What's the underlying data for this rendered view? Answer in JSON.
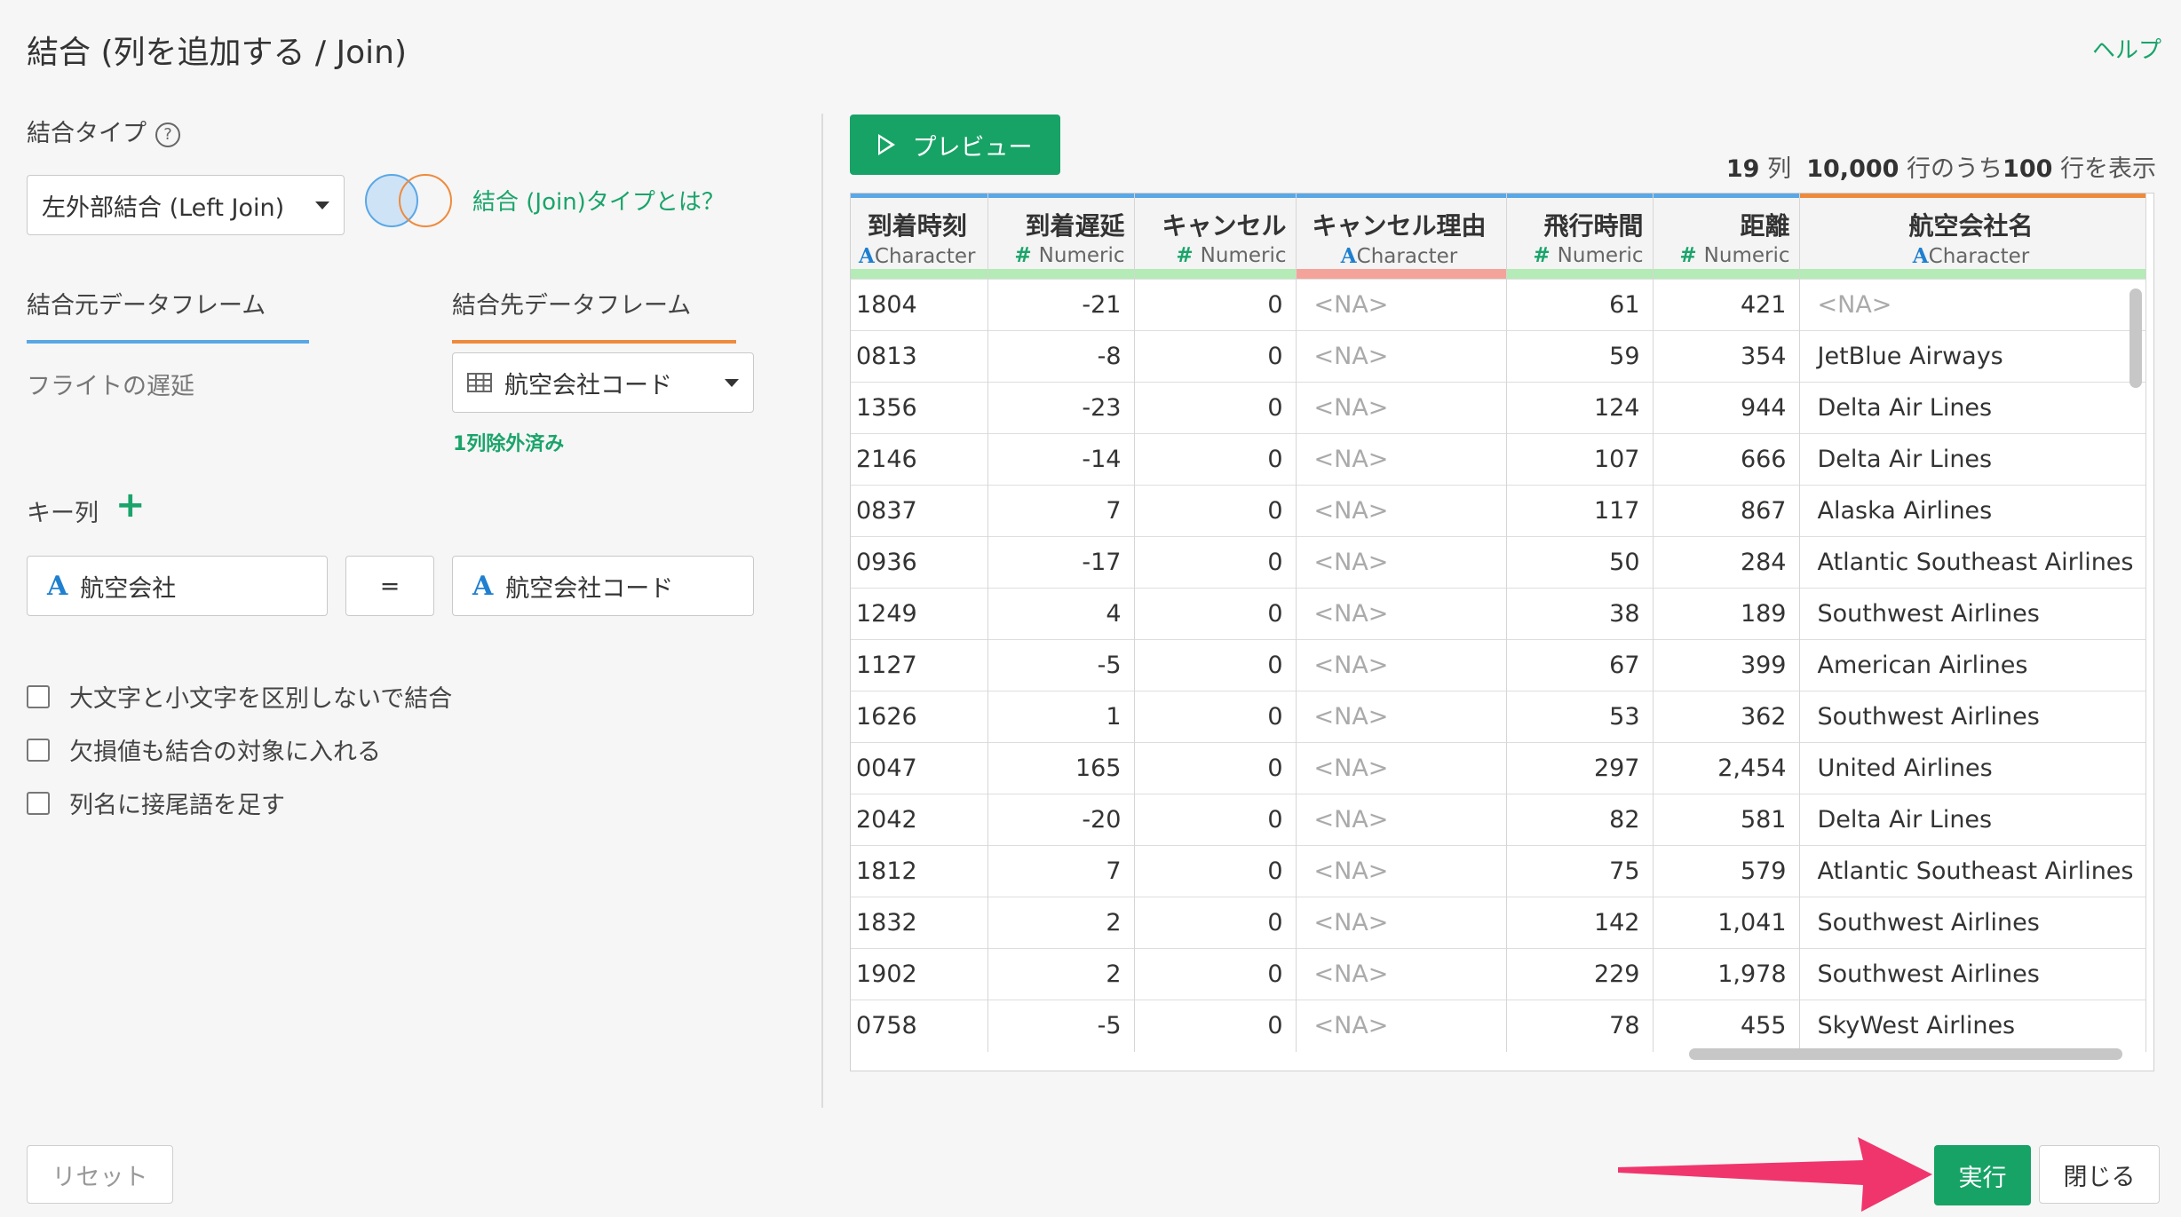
{
  "dialog": {
    "title": "結合 (列を追加する / Join)",
    "help_link": "ヘルプ"
  },
  "join_type": {
    "label": "結合タイプ",
    "help_icon": "question-circle-icon",
    "selected": "左外部結合 (Left Join)",
    "venn_icon": "venn-left-join-icon",
    "link": "結合 (Join)タイプとは？"
  },
  "source": {
    "tab_label": "結合元データフレーム",
    "value": "フライトの遅延"
  },
  "target": {
    "tab_label": "結合先データフレーム",
    "selected": "航空会社コード",
    "table_icon": "table-grid-icon",
    "excluded_note": "1列除外済み"
  },
  "key_columns": {
    "label": "キー列",
    "add_icon": "plus-icon",
    "left": "航空会社",
    "operator": "=",
    "right": "航空会社コード",
    "type_letter": "A"
  },
  "options": [
    {
      "label": "大文字と小文字を区別しないで結合",
      "checked": false
    },
    {
      "label": "欠損値も結合の対象に入れる",
      "checked": false
    },
    {
      "label": "列名に接尾語を足す",
      "checked": false
    }
  ],
  "preview": {
    "button_label": "プレビュー",
    "summary_cols": "19",
    "summary_cols_unit": "列",
    "summary_total": "10,000",
    "summary_mid": "行のうち",
    "summary_shown": "100",
    "summary_tail": "行を表示"
  },
  "table": {
    "columns": [
      {
        "name": "到着時刻",
        "type": "Character",
        "type_mark": "A",
        "align": "left",
        "top_color": "#5aa7e6",
        "bar_color": "#b4ebb6"
      },
      {
        "name": "到着遅延",
        "type": "Numeric",
        "type_mark": "#",
        "align": "right",
        "top_color": "#5aa7e6",
        "bar_color": "#b4ebb6"
      },
      {
        "name": "キャンセル",
        "type": "Numeric",
        "type_mark": "#",
        "align": "right",
        "top_color": "#5aa7e6",
        "bar_color": "#b4ebb6"
      },
      {
        "name": "キャンセル理由",
        "type": "Character",
        "type_mark": "A",
        "align": "left",
        "top_color": "#5aa7e6",
        "bar_color": "#f4a39b"
      },
      {
        "name": "飛行時間",
        "type": "Numeric",
        "type_mark": "#",
        "align": "right",
        "top_color": "#5aa7e6",
        "bar_color": "#b4ebb6"
      },
      {
        "name": "距離",
        "type": "Numeric",
        "type_mark": "#",
        "align": "right",
        "top_color": "#5aa7e6",
        "bar_color": "#b4ebb6"
      },
      {
        "name": "航空会社名",
        "type": "Character",
        "type_mark": "A",
        "align": "left",
        "top_color": "#ef8a3c",
        "bar_color": "#b4ebb6"
      }
    ],
    "rows": [
      [
        "1804",
        "-21",
        "0",
        "<NA>",
        "61",
        "421",
        "<NA>"
      ],
      [
        "0813",
        "-8",
        "0",
        "<NA>",
        "59",
        "354",
        "JetBlue Airways"
      ],
      [
        "1356",
        "-23",
        "0",
        "<NA>",
        "124",
        "944",
        "Delta Air Lines"
      ],
      [
        "2146",
        "-14",
        "0",
        "<NA>",
        "107",
        "666",
        "Delta Air Lines"
      ],
      [
        "0837",
        "7",
        "0",
        "<NA>",
        "117",
        "867",
        "Alaska Airlines"
      ],
      [
        "0936",
        "-17",
        "0",
        "<NA>",
        "50",
        "284",
        "Atlantic Southeast Airlines"
      ],
      [
        "1249",
        "4",
        "0",
        "<NA>",
        "38",
        "189",
        "Southwest Airlines"
      ],
      [
        "1127",
        "-5",
        "0",
        "<NA>",
        "67",
        "399",
        "American Airlines"
      ],
      [
        "1626",
        "1",
        "0",
        "<NA>",
        "53",
        "362",
        "Southwest Airlines"
      ],
      [
        "0047",
        "165",
        "0",
        "<NA>",
        "297",
        "2,454",
        "United Airlines"
      ],
      [
        "2042",
        "-20",
        "0",
        "<NA>",
        "82",
        "581",
        "Delta Air Lines"
      ],
      [
        "1812",
        "7",
        "0",
        "<NA>",
        "75",
        "579",
        "Atlantic Southeast Airlines"
      ],
      [
        "1832",
        "2",
        "0",
        "<NA>",
        "142",
        "1,041",
        "Southwest Airlines"
      ],
      [
        "1902",
        "2",
        "0",
        "<NA>",
        "229",
        "1,978",
        "Southwest Airlines"
      ],
      [
        "0758",
        "-5",
        "0",
        "<NA>",
        "78",
        "455",
        "SkyWest Airlines"
      ]
    ]
  },
  "footer": {
    "reset_label": "リセット",
    "run_label": "実行",
    "close_label": "閉じる",
    "arrow_color": "#f0356d"
  },
  "colors": {
    "accent_green": "#17a366",
    "blue": "#5aa7e6",
    "orange": "#ef8a3c"
  }
}
